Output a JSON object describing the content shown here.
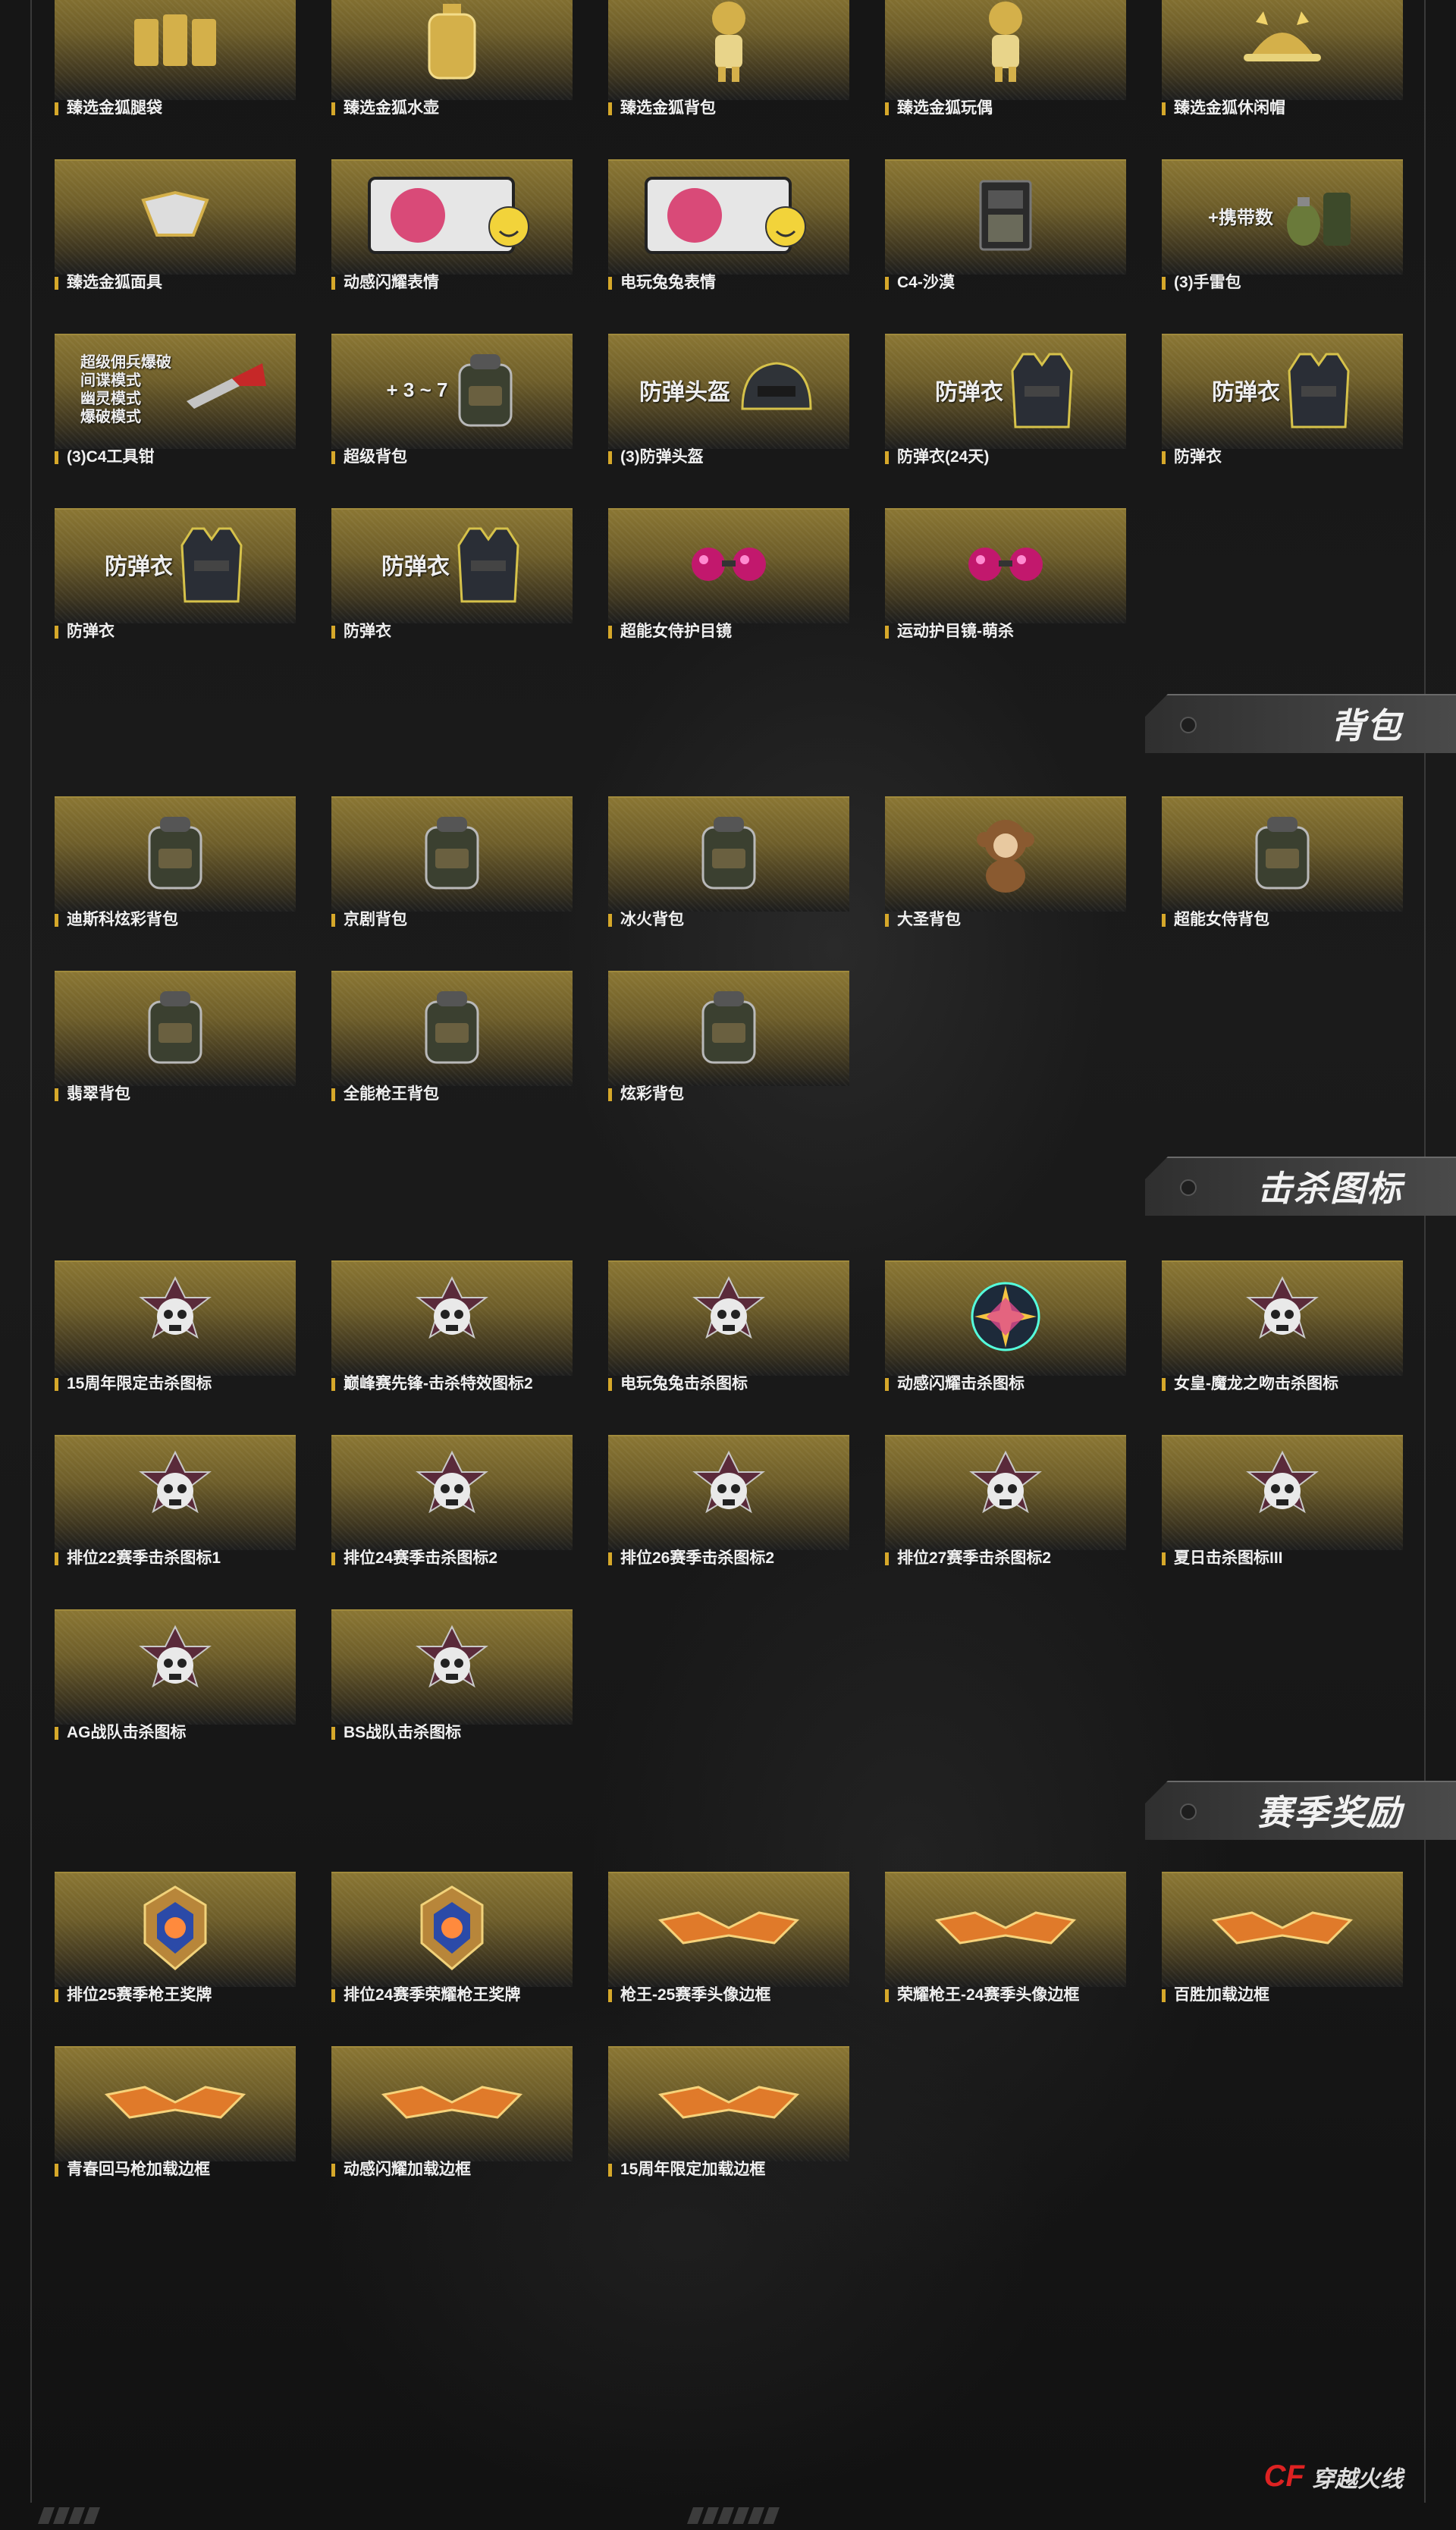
{
  "sections": [
    {
      "title": "",
      "items": [
        {
          "label": "臻选金狐腿袋",
          "icon": "bag-icon"
        },
        {
          "label": "臻选金狐水壶",
          "icon": "flask-icon"
        },
        {
          "label": "臻选金狐背包",
          "icon": "figure-icon"
        },
        {
          "label": "臻选金狐玩偶",
          "icon": "figure-icon"
        },
        {
          "label": "臻选金狐休闲帽",
          "icon": "hat-icon"
        },
        {
          "label": "臻选金狐面具",
          "icon": "mask-icon"
        },
        {
          "label": "动感闪耀表情",
          "icon": "emoji-icon"
        },
        {
          "label": "电玩兔兔表情",
          "icon": "emoji-icon"
        },
        {
          "label": "C4-沙漠",
          "icon": "c4-icon"
        },
        {
          "label": "(3)手雷包",
          "icon": "grenade-icon",
          "img_text": "+携带数"
        },
        {
          "label": "(3)C4工具钳",
          "icon": "pliers-icon",
          "img_text": "超级佣兵爆破\n间谍模式\n幽灵模式\n爆破模式"
        },
        {
          "label": "超级背包",
          "icon": "backpack-icon",
          "img_text": "+ 3 ~ 7"
        },
        {
          "label": "(3)防弹头盔",
          "icon": "helmet-icon",
          "img_text": "防弹头盔"
        },
        {
          "label": "防弹衣(24天)",
          "icon": "vest-icon",
          "img_text": "防弹衣"
        },
        {
          "label": "防弹衣",
          "icon": "vest-icon",
          "img_text": "防弹衣"
        },
        {
          "label": "防弹衣",
          "icon": "vest-icon",
          "img_text": "防弹衣"
        },
        {
          "label": "防弹衣",
          "icon": "vest-icon",
          "img_text": "防弹衣"
        },
        {
          "label": "超能女侍护目镜",
          "icon": "goggles-icon"
        },
        {
          "label": "运动护目镜-萌杀",
          "icon": "goggles-icon"
        }
      ]
    },
    {
      "title": "背包",
      "items": [
        {
          "label": "迪斯科炫彩背包",
          "icon": "backpack-icon"
        },
        {
          "label": "京剧背包",
          "icon": "backpack-icon"
        },
        {
          "label": "冰火背包",
          "icon": "backpack-icon"
        },
        {
          "label": "大圣背包",
          "icon": "monkey-icon"
        },
        {
          "label": "超能女侍背包",
          "icon": "backpack-icon"
        },
        {
          "label": "翡翠背包",
          "icon": "backpack-icon"
        },
        {
          "label": "全能枪王背包",
          "icon": "backpack-icon"
        },
        {
          "label": "炫彩背包",
          "icon": "backpack-icon"
        }
      ]
    },
    {
      "title": "击杀图标",
      "items": [
        {
          "label": "15周年限定击杀图标",
          "icon": "skull-icon"
        },
        {
          "label": "巅峰赛先锋-击杀特效图标2",
          "icon": "skull-icon"
        },
        {
          "label": "电玩兔兔击杀图标",
          "icon": "skull-icon"
        },
        {
          "label": "动感闪耀击杀图标",
          "icon": "star-icon"
        },
        {
          "label": "女皇-魔龙之吻击杀图标",
          "icon": "skull-icon"
        },
        {
          "label": "排位22赛季击杀图标1",
          "icon": "skull-icon"
        },
        {
          "label": "排位24赛季击杀图标2",
          "icon": "skull-icon"
        },
        {
          "label": "排位26赛季击杀图标2",
          "icon": "skull-icon"
        },
        {
          "label": "排位27赛季击杀图标2",
          "icon": "skull-icon"
        },
        {
          "label": "夏日击杀图标III",
          "icon": "skull-icon"
        },
        {
          "label": "AG战队击杀图标",
          "icon": "skull-icon"
        },
        {
          "label": "BS战队击杀图标",
          "icon": "skull-icon"
        }
      ]
    },
    {
      "title": "赛季奖励",
      "items": [
        {
          "label": "排位25赛季枪王奖牌",
          "icon": "medal-icon"
        },
        {
          "label": "排位24赛季荣耀枪王奖牌",
          "icon": "medal-icon"
        },
        {
          "label": "枪王-25赛季头像边框",
          "icon": "frame-icon"
        },
        {
          "label": "荣耀枪王-24赛季头像边框",
          "icon": "frame-icon"
        },
        {
          "label": "百胜加载边框",
          "icon": "frame-icon"
        },
        {
          "label": "青春回马枪加载边框",
          "icon": "frame-icon"
        },
        {
          "label": "动感闪耀加载边框",
          "icon": "frame-icon"
        },
        {
          "label": "15周年限定加载边框",
          "icon": "frame-icon"
        }
      ]
    }
  ],
  "logo": {
    "mark": "CF",
    "text": "穿越火线"
  },
  "colors": {
    "accent": "#d6a82a",
    "card_top": "#8a7633",
    "background": "#161616"
  }
}
